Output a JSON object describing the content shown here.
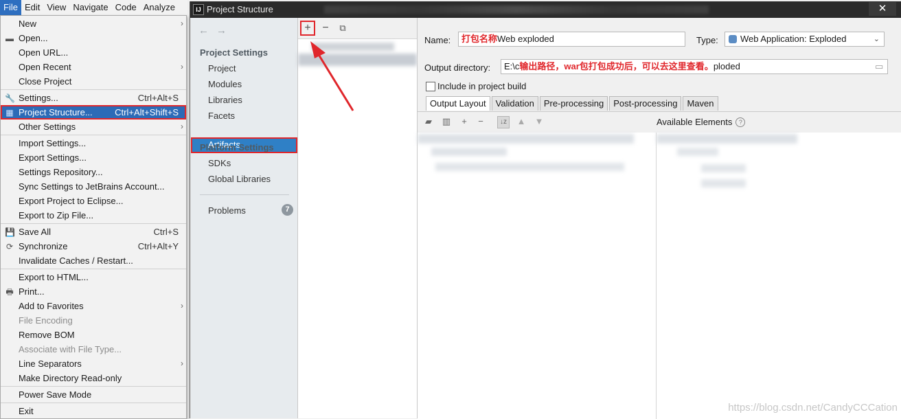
{
  "menubar": {
    "items": [
      "File",
      "Edit",
      "View",
      "Navigate",
      "Code",
      "Analyze"
    ]
  },
  "file_menu": {
    "items": [
      {
        "label": "New",
        "submenu": true
      },
      {
        "label": "Open...",
        "icon": "folder-icon"
      },
      {
        "label": "Open URL..."
      },
      {
        "label": "Open Recent",
        "submenu": true
      },
      {
        "label": "Close Project"
      },
      {
        "label": "Settings...",
        "shortcut": "Ctrl+Alt+S",
        "icon": "wrench-icon"
      },
      {
        "label": "Project Structure...",
        "shortcut": "Ctrl+Alt+Shift+S",
        "icon": "project-structure-icon",
        "highlighted": true
      },
      {
        "label": "Other Settings",
        "submenu": true
      },
      {
        "label": "Import Settings..."
      },
      {
        "label": "Export Settings..."
      },
      {
        "label": "Settings Repository..."
      },
      {
        "label": "Sync Settings to JetBrains Account..."
      },
      {
        "label": "Export Project to Eclipse..."
      },
      {
        "label": "Export to Zip File..."
      },
      {
        "label": "Save All",
        "shortcut": "Ctrl+S",
        "icon": "save-icon"
      },
      {
        "label": "Synchronize",
        "shortcut": "Ctrl+Alt+Y",
        "icon": "sync-icon"
      },
      {
        "label": "Invalidate Caches / Restart..."
      },
      {
        "label": "Export to HTML..."
      },
      {
        "label": "Print...",
        "icon": "print-icon"
      },
      {
        "label": "Add to Favorites",
        "submenu": true
      },
      {
        "label": "File Encoding",
        "disabled": true
      },
      {
        "label": "Remove BOM"
      },
      {
        "label": "Associate with File Type...",
        "disabled": true
      },
      {
        "label": "Line Separators",
        "submenu": true
      },
      {
        "label": "Make Directory Read-only"
      },
      {
        "label": "Power Save Mode"
      },
      {
        "label": "Exit"
      }
    ]
  },
  "dialog": {
    "title": "Project Structure",
    "logo": "IJ",
    "close": "✕",
    "nav": {
      "project_settings_header": "Project Settings",
      "project_settings": [
        "Project",
        "Modules",
        "Libraries",
        "Facets",
        "Artifacts"
      ],
      "platform_settings_header": "Platform Settings",
      "platform_settings": [
        "SDKs",
        "Global Libraries"
      ],
      "problems": "Problems",
      "problems_count": "7",
      "selected": "Artifacts"
    },
    "artifact_tools": {
      "add": "+",
      "remove": "−",
      "copy": "⧉"
    },
    "detail": {
      "name_label": "Name:",
      "name_annotation": "打包名称",
      "name_value": "Web exploded",
      "type_label": "Type:",
      "type_value": "Web Application: Exploded",
      "output_label": "Output directory:",
      "output_prefix": "E:\\c",
      "output_annotation": "输出路径，war包打包成功后，可以去这里查看。",
      "output_suffix": "ploded",
      "include_label": "Include in project build",
      "tabs": [
        "Output Layout",
        "Validation",
        "Pre-processing",
        "Post-processing",
        "Maven"
      ],
      "available_elements": "Available Elements",
      "help": "?"
    }
  },
  "watermark": "https://blog.csdn.net/CandyCCCation",
  "colors": {
    "highlight_blue": "#2c6bb7",
    "annotation_red": "#e0262b",
    "title_bar": "#2b2b2b"
  }
}
